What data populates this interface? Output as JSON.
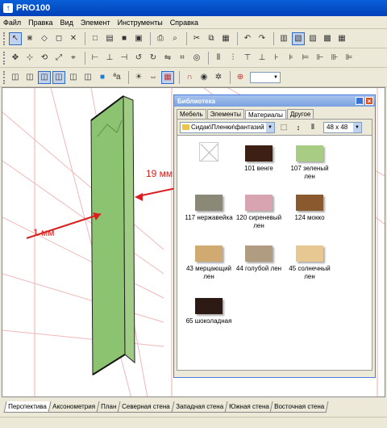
{
  "window": {
    "title": "PRO100"
  },
  "menu": [
    "Файл",
    "Правка",
    "Вид",
    "Элемент",
    "Инструменты",
    "Справка"
  ],
  "annotations": {
    "left_label": "1 мм",
    "right_label": "19 мм"
  },
  "view_tabs": [
    "Перспектива",
    "Аксонометрия",
    "План",
    "Северная стена",
    "Западная стена",
    "Южная стена",
    "Восточная стена"
  ],
  "library": {
    "title": "Библиотека",
    "tabs": [
      "Мебель",
      "Элементы",
      "Материалы",
      "Другое"
    ],
    "active_tab": "Материалы",
    "path": "Сидак\\Пленки\\фантазий",
    "thumb_size": "48 x 48",
    "materials": [
      {
        "name": "",
        "color": "none"
      },
      {
        "name": "101 венге",
        "color": "#3e1f14"
      },
      {
        "name": "107 зеленый лен",
        "color": "#a9cc84"
      },
      {
        "name": "117 нержавейка",
        "color": "#8a8877"
      },
      {
        "name": "120 сиреневый лен",
        "color": "#d8a4b2"
      },
      {
        "name": "124 мокко",
        "color": "#8a5a2e"
      },
      {
        "name": "43 мерцающий лен",
        "color": "#d0aa70"
      },
      {
        "name": "44 голубой лен",
        "color": "#b09c80"
      },
      {
        "name": "45 солнечный лен",
        "color": "#e8c892"
      },
      {
        "name": "65 шоколадная",
        "color": "#2e1a14"
      }
    ]
  }
}
